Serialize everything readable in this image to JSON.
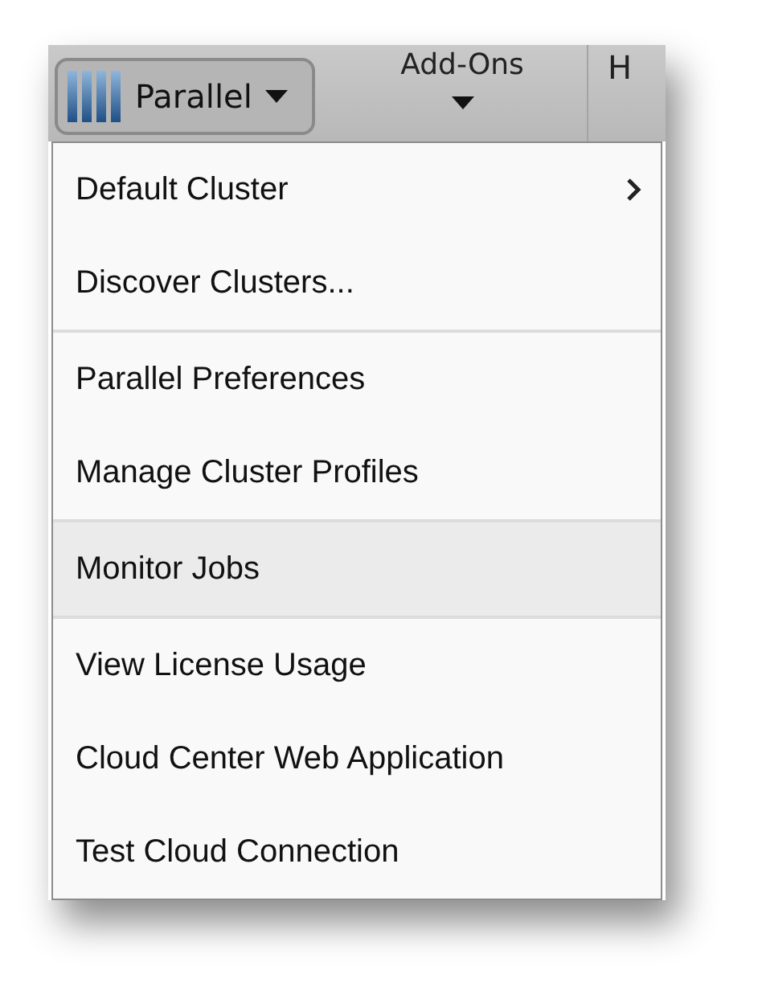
{
  "toolbar": {
    "parallel_button": {
      "label": "Parallel",
      "pressed": true
    },
    "add_ons": {
      "label": "Add-Ons"
    },
    "next_button": {
      "label": "H"
    }
  },
  "menu": {
    "groups": [
      [
        {
          "label": "Default Cluster",
          "has_submenu": true,
          "selected": false
        },
        {
          "label": "Discover Clusters...",
          "has_submenu": false,
          "selected": false
        }
      ],
      [
        {
          "label": "Parallel Preferences",
          "has_submenu": false,
          "selected": false
        },
        {
          "label": "Manage Cluster Profiles",
          "has_submenu": false,
          "selected": false
        }
      ],
      [
        {
          "label": "Monitor Jobs",
          "has_submenu": false,
          "selected": true
        }
      ],
      [
        {
          "label": "View License Usage",
          "has_submenu": false,
          "selected": false
        },
        {
          "label": "Cloud Center Web Application",
          "has_submenu": false,
          "selected": false
        },
        {
          "label": "Test Cloud Connection",
          "has_submenu": false,
          "selected": false
        }
      ]
    ]
  }
}
